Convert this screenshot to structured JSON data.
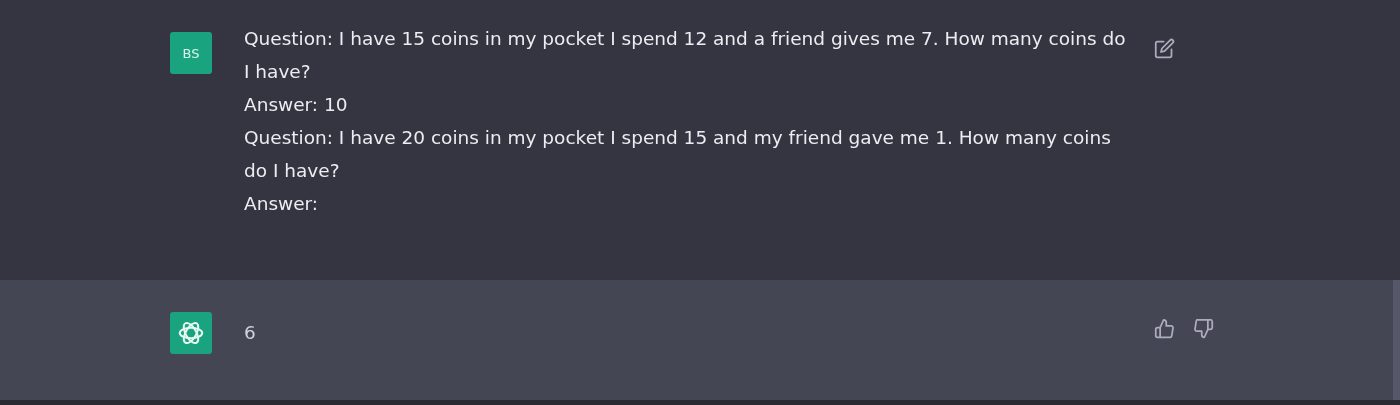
{
  "messages": [
    {
      "kind": "user",
      "avatar": "BS",
      "lines": [
        "Question: I have 15 coins in my pocket I spend 12 and a friend gives me 7. How many coins do I have?",
        "Answer: 10",
        "Question: I have 20 coins in my pocket I spend 15 and my friend gave me 1. How many coins do I have?",
        "Answer:"
      ]
    },
    {
      "kind": "assistant",
      "lines": [
        "6"
      ]
    }
  ]
}
